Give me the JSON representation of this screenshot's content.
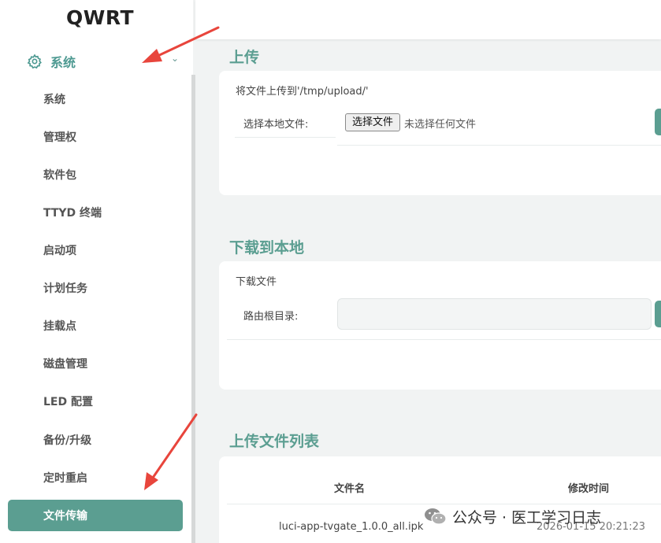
{
  "brand": "QWRT",
  "sidebar": {
    "group": {
      "label": "系统",
      "icon": "gear-icon"
    },
    "items": [
      {
        "label": "系统"
      },
      {
        "label": "管理权"
      },
      {
        "label": "软件包"
      },
      {
        "label": "TTYD 终端"
      },
      {
        "label": "启动项"
      },
      {
        "label": "计划任务"
      },
      {
        "label": "挂载点"
      },
      {
        "label": "磁盘管理"
      },
      {
        "label": "LED 配置"
      },
      {
        "label": "备份/升级"
      },
      {
        "label": "定时重启"
      },
      {
        "label": "文件传输",
        "active": true
      }
    ]
  },
  "upload": {
    "title": "上传",
    "description": "将文件上传到'/tmp/upload/'",
    "choose_label": "选择本地文件:",
    "choose_button": "选择文件",
    "no_file": "未选择任何文件"
  },
  "download": {
    "title": "下载到本地",
    "description": "下载文件",
    "path_label": "路由根目录:",
    "path_value": ""
  },
  "file_list": {
    "title": "上传文件列表",
    "columns": [
      "文件名",
      "修改时间"
    ],
    "rows": [
      {
        "name": "luci-app-tvgate_1.0.0_all.ipk",
        "mtime": "2026-01-15 20:21:23"
      }
    ]
  },
  "watermark": {
    "text": "公众号 · 医工学习日志"
  },
  "colors": {
    "accent": "#5b9e91",
    "arrow": "#e8453c"
  }
}
